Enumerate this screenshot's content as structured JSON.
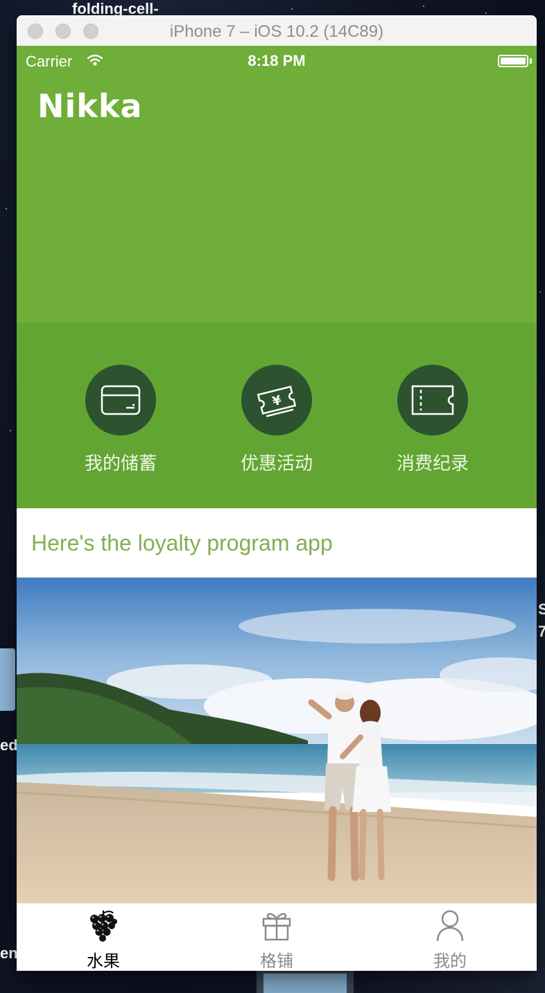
{
  "desktop": {
    "top_label": "folding-cell-",
    "left_labels": [
      "ed",
      "eng"
    ],
    "right_labels": [
      "S",
      "7"
    ]
  },
  "simulator": {
    "title": "iPhone 7 – iOS 10.2 (14C89)"
  },
  "status_bar": {
    "carrier": "Carrier",
    "time": "8:18 PM",
    "battery_level": 1.0
  },
  "app": {
    "brand": "Nikka",
    "actions": [
      {
        "label": "我的储蓄",
        "icon": "card-icon"
      },
      {
        "label": "优惠活动",
        "icon": "yen-ticket-icon"
      },
      {
        "label": "消费纪录",
        "icon": "ticket-icon"
      }
    ],
    "promo_text": "Here's the loyalty program app",
    "banner_image": "beach-couple-photo"
  },
  "tab_bar": {
    "tabs": [
      {
        "label": "水果",
        "icon": "grapes-icon",
        "selected": true
      },
      {
        "label": "格铺",
        "icon": "gift-icon",
        "selected": false
      },
      {
        "label": "我的",
        "icon": "person-icon",
        "selected": false
      }
    ]
  },
  "colors": {
    "header_green": "#6fae38",
    "actions_green": "#62a533",
    "action_circle": "#2c5230",
    "promo_text": "#83ae55",
    "tab_selected": "#000000",
    "tab_unselected": "#8a8a8a"
  }
}
